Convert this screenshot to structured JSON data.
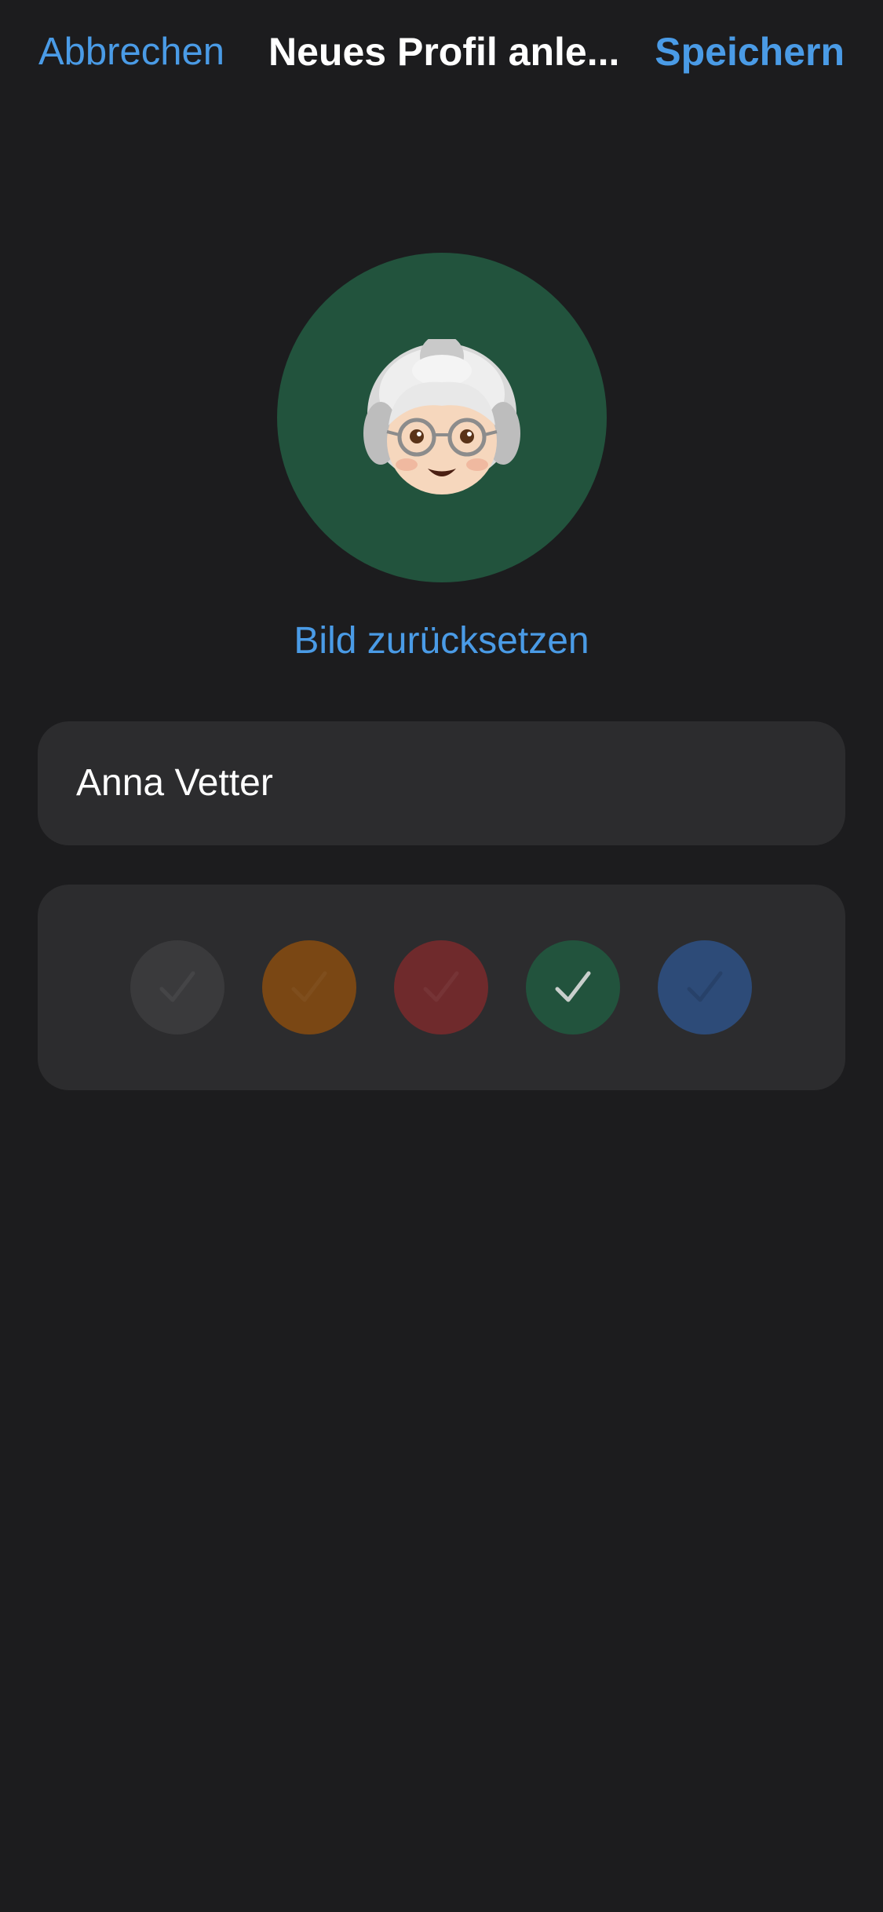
{
  "nav": {
    "cancel_label": "Abbrechen",
    "title": "Neues Profil anle...",
    "save_label": "Speichern"
  },
  "avatar": {
    "icon": "older-woman-emoji",
    "background_color": "#22533d"
  },
  "reset_label": "Bild zurücksetzen",
  "name_field": {
    "value": "Anna Vetter"
  },
  "color_options": [
    {
      "name": "gray",
      "color": "#3a3a3c",
      "selected": false
    },
    {
      "name": "orange",
      "color": "#7a4714",
      "selected": false
    },
    {
      "name": "red",
      "color": "#6f2a2c",
      "selected": false
    },
    {
      "name": "green",
      "color": "#22533d",
      "selected": true
    },
    {
      "name": "blue",
      "color": "#2d4b78",
      "selected": false
    }
  ],
  "colors": {
    "background": "#1c1c1e",
    "card": "#2c2c2e",
    "accent": "#4a9be6"
  }
}
